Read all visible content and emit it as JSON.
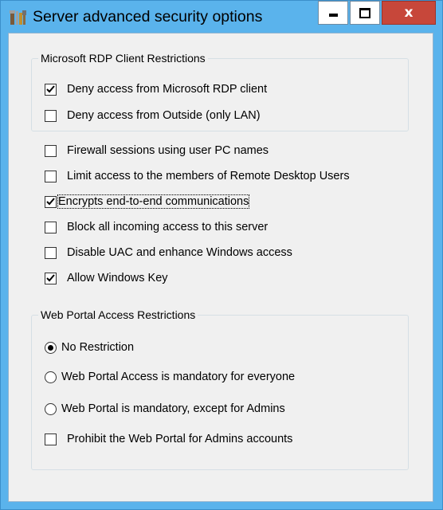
{
  "window": {
    "title": "Server advanced security options",
    "close_glyph": "x",
    "background": "#5ab3ec",
    "close_color": "#c7473a"
  },
  "rdp_group": {
    "title": "Microsoft RDP Client Restrictions",
    "options": [
      {
        "label": "Deny access from Microsoft RDP client",
        "checked": true
      },
      {
        "label": "Deny access from Outside (only LAN)",
        "checked": false
      }
    ]
  },
  "general_options": [
    {
      "label": "Firewall sessions using user PC names",
      "checked": false
    },
    {
      "label": "Limit access to the members of Remote Desktop Users",
      "checked": false
    },
    {
      "label": "Encrypts end-to-end communications",
      "checked": true,
      "focused": true
    },
    {
      "label": "Block all incoming access to this server",
      "checked": false
    },
    {
      "label": "Disable UAC and enhance Windows access",
      "checked": false
    },
    {
      "label": "Allow Windows Key",
      "checked": true
    }
  ],
  "web_group": {
    "title": "Web Portal Access Restrictions",
    "radios": [
      {
        "label": "No Restriction",
        "selected": true
      },
      {
        "label": "Web Portal Access is mandatory for everyone",
        "selected": false
      },
      {
        "label": "Web Portal is mandatory, except for Admins",
        "selected": false
      }
    ],
    "checkbox": {
      "label": "Prohibit the Web Portal for Admins accounts",
      "checked": false
    }
  },
  "icons": {
    "app": "tools-icon",
    "minimize": "minimize-icon",
    "maximize": "maximize-icon",
    "close": "close-icon",
    "check": "checkmark-icon",
    "radio": "radio-dot-icon"
  }
}
